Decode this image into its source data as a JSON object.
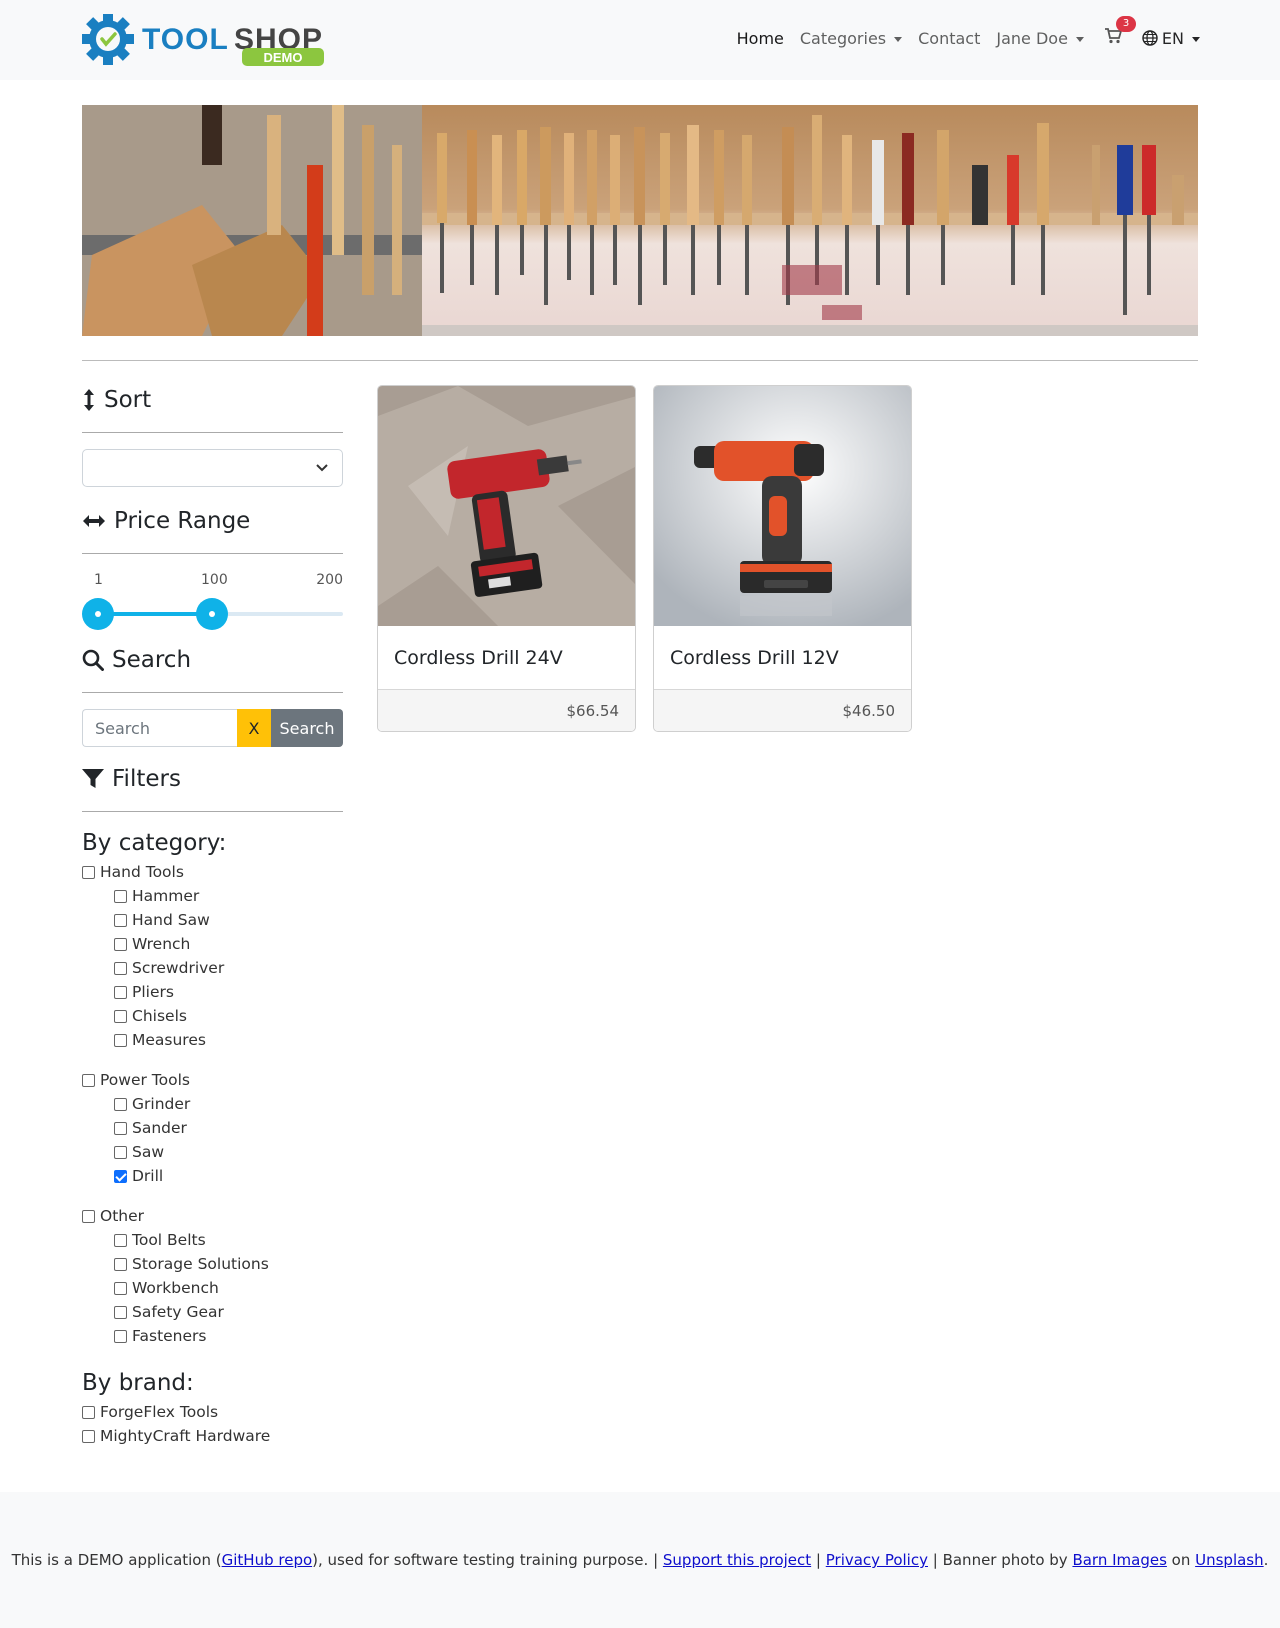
{
  "brand": {
    "name": "TOOLSHOP",
    "tag": "DEMO",
    "color": "#1a7fc1",
    "tag_color": "#8cc63f"
  },
  "nav": {
    "home": "Home",
    "categories": "Categories",
    "contact": "Contact",
    "user": "Jane Doe",
    "cart_count": "3",
    "language": "EN"
  },
  "sidebar": {
    "sort_title": "Sort",
    "sort_value": "",
    "price_title": "Price Range",
    "price_min": "1",
    "price_max": "200",
    "price_selected": "100",
    "search_title": "Search",
    "search_placeholder": "Search",
    "clear_label": "X",
    "search_button": "Search",
    "filters_title": "Filters",
    "by_category": "By category:",
    "categories": [
      {
        "label": "Hand Tools",
        "checked": false,
        "children": [
          {
            "label": "Hammer",
            "checked": false
          },
          {
            "label": "Hand Saw",
            "checked": false
          },
          {
            "label": "Wrench",
            "checked": false
          },
          {
            "label": "Screwdriver",
            "checked": false
          },
          {
            "label": "Pliers",
            "checked": false
          },
          {
            "label": "Chisels",
            "checked": false
          },
          {
            "label": "Measures",
            "checked": false
          }
        ]
      },
      {
        "label": "Power Tools",
        "checked": false,
        "children": [
          {
            "label": "Grinder",
            "checked": false
          },
          {
            "label": "Sander",
            "checked": false
          },
          {
            "label": "Saw",
            "checked": false
          },
          {
            "label": "Drill",
            "checked": true
          }
        ]
      },
      {
        "label": "Other",
        "checked": false,
        "children": [
          {
            "label": "Tool Belts",
            "checked": false
          },
          {
            "label": "Storage Solutions",
            "checked": false
          },
          {
            "label": "Workbench",
            "checked": false
          },
          {
            "label": "Safety Gear",
            "checked": false
          },
          {
            "label": "Fasteners",
            "checked": false
          }
        ]
      }
    ],
    "by_brand": "By brand:",
    "brands": [
      {
        "label": "ForgeFlex Tools",
        "checked": false
      },
      {
        "label": "MightyCraft Hardware",
        "checked": false
      }
    ]
  },
  "products": [
    {
      "name": "Cordless Drill 24V",
      "price": "$66.54"
    },
    {
      "name": "Cordless Drill 12V",
      "price": "$46.50"
    }
  ],
  "footer": {
    "t1": "This is a DEMO application (",
    "github": "GitHub repo",
    "t2": "), used for software testing training purpose. | ",
    "support": "Support this project",
    "t3": " | ",
    "privacy": "Privacy Policy",
    "t4": " | Banner photo by ",
    "barn": "Barn Images",
    "t5": " on ",
    "unsplash": "Unsplash",
    "t6": "."
  }
}
